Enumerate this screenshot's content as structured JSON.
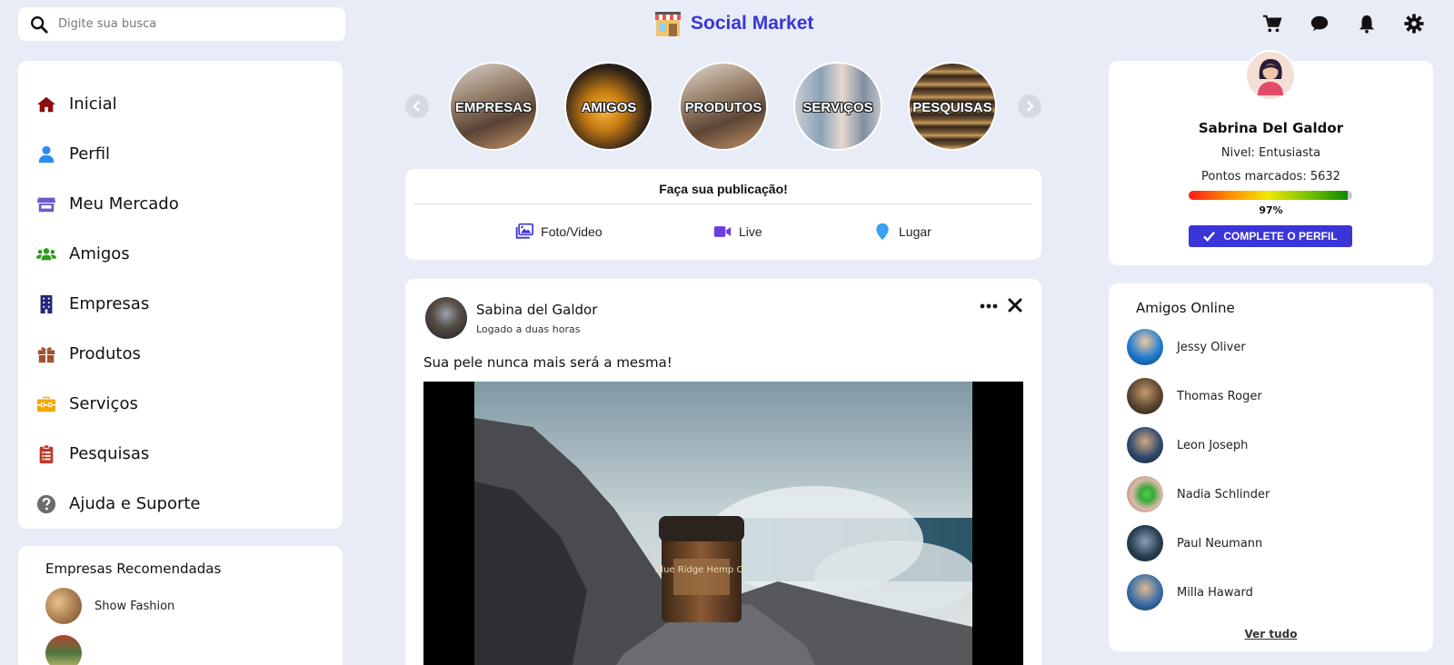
{
  "search": {
    "placeholder": "Digite sua busca",
    "icon": "search-icon"
  },
  "brand": {
    "title": "Social Market",
    "color": "#3a35d8",
    "logo": "shop-logo"
  },
  "top_icons": [
    "cart-icon",
    "chat-icon",
    "bell-icon",
    "gear-icon"
  ],
  "menu": {
    "items": [
      {
        "label": "Inicial",
        "icon": "home-icon",
        "color": "#8b0d0d"
      },
      {
        "label": "Perfil",
        "icon": "user-icon",
        "color": "#2a8df0"
      },
      {
        "label": "Meu Mercado",
        "icon": "store-icon",
        "color": "#6a5acd"
      },
      {
        "label": "Amigos",
        "icon": "users-icon",
        "color": "#2e9a1f"
      },
      {
        "label": "Empresas",
        "icon": "building-icon",
        "color": "#22287a"
      },
      {
        "label": "Produtos",
        "icon": "gift-icon",
        "color": "#a0522d"
      },
      {
        "label": "Serviços",
        "icon": "toolbox-icon",
        "color": "#f2a900"
      },
      {
        "label": "Pesquisas",
        "icon": "clipboard-icon",
        "color": "#c0392b"
      },
      {
        "label": "Ajuda e Suporte",
        "icon": "help-icon",
        "color": "#6d6d6d"
      }
    ]
  },
  "recommended": {
    "title": "Empresas Recomendadas",
    "items": [
      {
        "name": "Show Fashion"
      }
    ]
  },
  "stories": [
    {
      "label": "EMPRESAS"
    },
    {
      "label": "AMIGOS"
    },
    {
      "label": "PRODUTOS"
    },
    {
      "label": "SERVIÇOS"
    },
    {
      "label": "PESQUISAS"
    }
  ],
  "publish": {
    "title": "Faça sua publicação!",
    "actions": [
      {
        "label": "Foto/Video",
        "icon": "photo-icon",
        "color": "#3a35d8"
      },
      {
        "label": "Live",
        "icon": "video-icon",
        "color": "#6a3fe0"
      },
      {
        "label": "Lugar",
        "icon": "map-pin-icon",
        "color": "#3aa0f0"
      }
    ]
  },
  "post": {
    "author": "Sabina del Galdor",
    "time": "Logado a duas horas",
    "text": "Sua pele nunca mais será a mesma!",
    "image_label": "Blue Ridge Hemp Co"
  },
  "profile": {
    "name": "Sabrina Del Galdor",
    "level": "Nivel: Entusiasta",
    "points": "Pontos marcados: 5632",
    "progress": 97,
    "progress_label": "97%",
    "cta": "COMPLETE O PERFIL"
  },
  "friends_online": {
    "title": "Amigos Online",
    "items": [
      {
        "name": "Jessy Oliver",
        "color": "#1e7bd0"
      },
      {
        "name": "Thomas Roger",
        "color": "#5a4632"
      },
      {
        "name": "Leon Joseph",
        "color": "#2f4a70"
      },
      {
        "name": "Nadia Schlinder",
        "color": "#d9b8a8"
      },
      {
        "name": "Paul Neumann",
        "color": "#2a3f52"
      },
      {
        "name": "Milla Haward",
        "color": "#3a6ea8"
      }
    ],
    "see_all": "Ver tudo"
  }
}
